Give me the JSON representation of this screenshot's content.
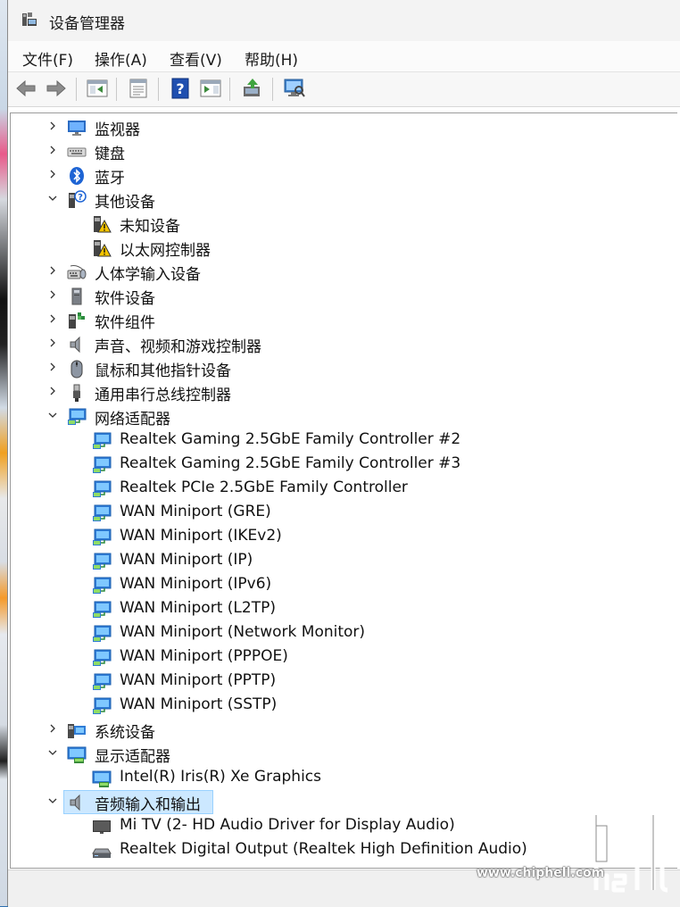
{
  "window": {
    "title": "设备管理器"
  },
  "menu": [
    {
      "label": "文件(F)"
    },
    {
      "label": "操作(A)"
    },
    {
      "label": "查看(V)"
    },
    {
      "label": "帮助(H)"
    }
  ],
  "toolbar": [
    {
      "icon": "back-arrow-icon"
    },
    {
      "icon": "forward-arrow-icon"
    },
    {
      "icon": "show-hide-console-tree-icon"
    },
    {
      "icon": "properties-icon"
    },
    {
      "icon": "help-icon"
    },
    {
      "icon": "action-pane-icon"
    },
    {
      "icon": "update-driver-icon"
    },
    {
      "icon": "scan-hardware-icon"
    }
  ],
  "tree": [
    {
      "label": "监视器",
      "level": 0,
      "expanded": false,
      "icon": "monitor-icon"
    },
    {
      "label": "键盘",
      "level": 0,
      "expanded": false,
      "icon": "keyboard-icon"
    },
    {
      "label": "蓝牙",
      "level": 0,
      "expanded": false,
      "icon": "bluetooth-icon"
    },
    {
      "label": "其他设备",
      "level": 0,
      "expanded": true,
      "icon": "other-devices-icon"
    },
    {
      "label": "未知设备",
      "level": 1,
      "icon": "warning-device-icon"
    },
    {
      "label": "以太网控制器",
      "level": 1,
      "icon": "warning-device-icon"
    },
    {
      "label": "人体学输入设备",
      "level": 0,
      "expanded": false,
      "icon": "hid-icon"
    },
    {
      "label": "软件设备",
      "level": 0,
      "expanded": false,
      "icon": "software-device-icon"
    },
    {
      "label": "软件组件",
      "level": 0,
      "expanded": false,
      "icon": "software-component-icon"
    },
    {
      "label": "声音、视频和游戏控制器",
      "level": 0,
      "expanded": false,
      "icon": "speaker-icon"
    },
    {
      "label": "鼠标和其他指针设备",
      "level": 0,
      "expanded": false,
      "icon": "mouse-icon"
    },
    {
      "label": "通用串行总线控制器",
      "level": 0,
      "expanded": false,
      "icon": "usb-icon"
    },
    {
      "label": "网络适配器",
      "level": 0,
      "expanded": true,
      "icon": "network-adapter-icon"
    },
    {
      "label": "Realtek Gaming 2.5GbE Family Controller #2",
      "level": 1,
      "icon": "network-adapter-icon"
    },
    {
      "label": "Realtek Gaming 2.5GbE Family Controller #3",
      "level": 1,
      "icon": "network-adapter-icon"
    },
    {
      "label": "Realtek PCIe 2.5GbE Family Controller",
      "level": 1,
      "icon": "network-adapter-icon"
    },
    {
      "label": "WAN Miniport (GRE)",
      "level": 1,
      "icon": "network-adapter-icon"
    },
    {
      "label": "WAN Miniport (IKEv2)",
      "level": 1,
      "icon": "network-adapter-icon"
    },
    {
      "label": "WAN Miniport (IP)",
      "level": 1,
      "icon": "network-adapter-icon"
    },
    {
      "label": "WAN Miniport (IPv6)",
      "level": 1,
      "icon": "network-adapter-icon"
    },
    {
      "label": "WAN Miniport (L2TP)",
      "level": 1,
      "icon": "network-adapter-icon"
    },
    {
      "label": "WAN Miniport (Network Monitor)",
      "level": 1,
      "icon": "network-adapter-icon"
    },
    {
      "label": "WAN Miniport (PPPOE)",
      "level": 1,
      "icon": "network-adapter-icon"
    },
    {
      "label": "WAN Miniport (PPTP)",
      "level": 1,
      "icon": "network-adapter-icon"
    },
    {
      "label": "WAN Miniport (SSTP)",
      "level": 1,
      "icon": "network-adapter-icon"
    },
    {
      "label": "系统设备",
      "level": 0,
      "expanded": false,
      "icon": "system-devices-icon"
    },
    {
      "label": "显示适配器",
      "level": 0,
      "expanded": true,
      "icon": "display-adapter-icon"
    },
    {
      "label": "Intel(R) Iris(R) Xe Graphics",
      "level": 1,
      "icon": "display-adapter-icon"
    },
    {
      "label": "音频输入和输出",
      "level": 0,
      "expanded": true,
      "icon": "speaker-icon",
      "selected": true
    },
    {
      "label": "Mi TV (2- HD Audio Driver for Display Audio)",
      "level": 1,
      "icon": "tv-display-icon"
    },
    {
      "label": "Realtek Digital Output (Realtek High Definition Audio)",
      "level": 1,
      "icon": "audio-output-device-icon"
    }
  ],
  "watermark": {
    "text": "chip hell",
    "url": "www.chiphell.com"
  }
}
